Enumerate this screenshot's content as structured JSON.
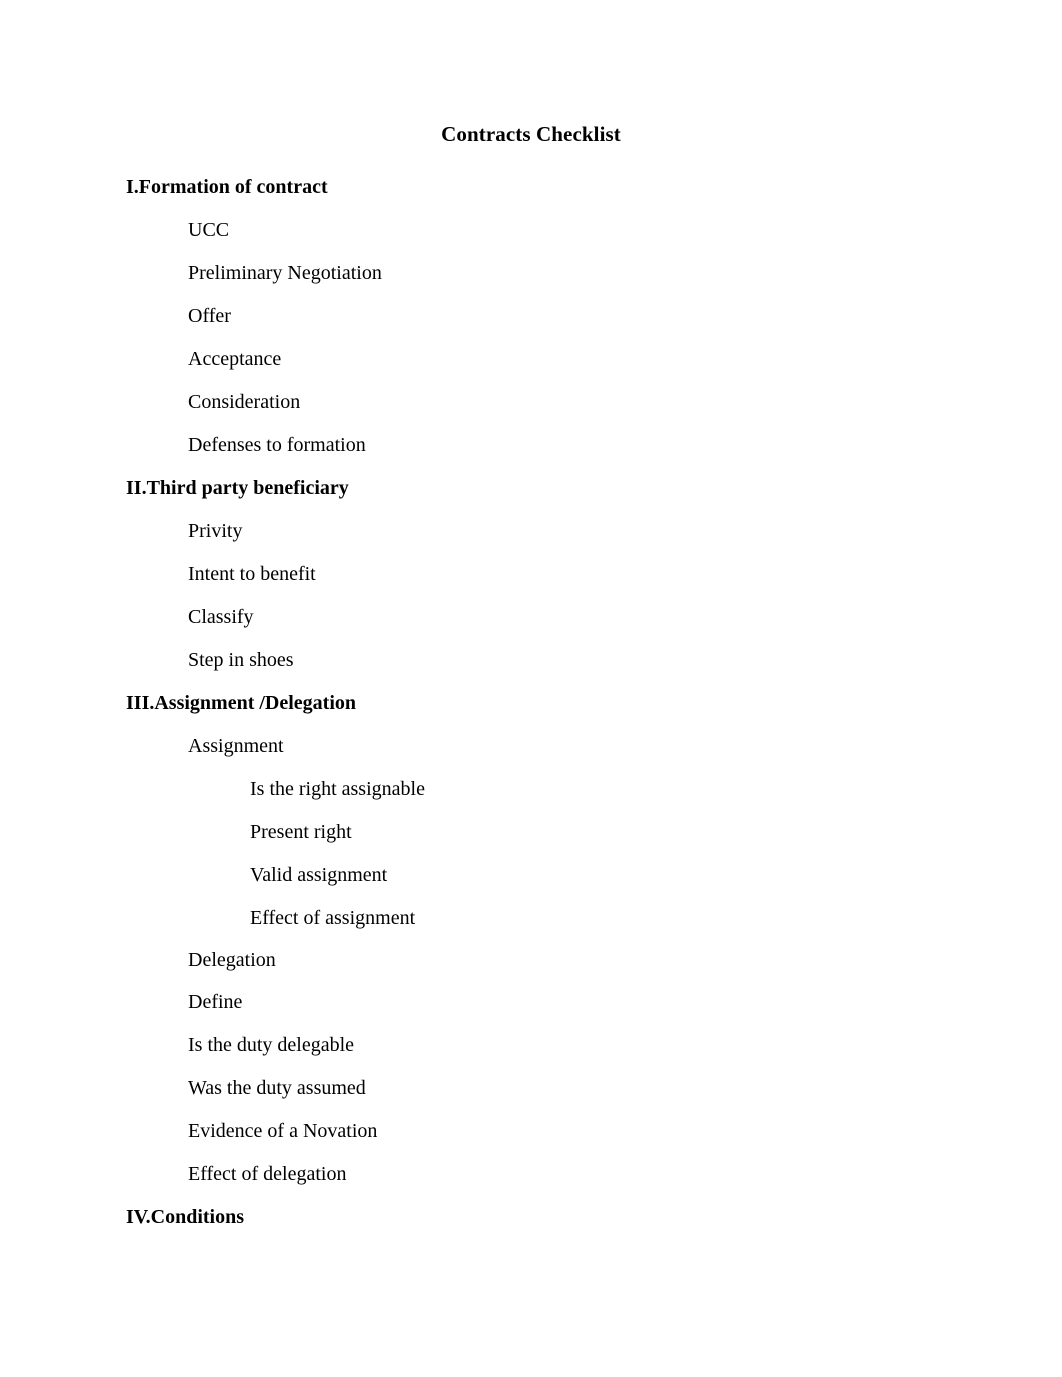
{
  "document": {
    "title": "Contracts Checklist",
    "page_background": "#ffffff",
    "text_color": "#000000"
  },
  "outline": [
    {
      "level": "heading",
      "text": "I.Formation of contract"
    },
    {
      "level": "item",
      "text": "UCC"
    },
    {
      "level": "item",
      "text": "Preliminary Negotiation"
    },
    {
      "level": "item",
      "text": "Offer"
    },
    {
      "level": "item",
      "text": "Acceptance"
    },
    {
      "level": "item",
      "text": "Consideration"
    },
    {
      "level": "item",
      "text": "Defenses to formation"
    },
    {
      "level": "heading",
      "text": "II.Third party beneficiary"
    },
    {
      "level": "item",
      "text": "Privity"
    },
    {
      "level": "item",
      "text": "Intent to benefit"
    },
    {
      "level": "item",
      "text": "Classify"
    },
    {
      "level": "item",
      "text": "Step in shoes"
    },
    {
      "level": "heading",
      "text": "III.Assignment /Delegation"
    },
    {
      "level": "item",
      "text": "Assignment"
    },
    {
      "level": "subitem",
      "text": "Is the right assignable"
    },
    {
      "level": "subitem",
      "text": "Present right"
    },
    {
      "level": "subitem",
      "text": "Valid assignment"
    },
    {
      "level": "subitem",
      "text": "Effect of assignment"
    },
    {
      "level": "item",
      "text": "Delegation"
    },
    {
      "level": "item",
      "text": "Define"
    },
    {
      "level": "item",
      "text": "Is the duty delegable"
    },
    {
      "level": "item",
      "text": "Was the duty assumed"
    },
    {
      "level": "item",
      "text": "Evidence of a Novation"
    },
    {
      "level": "item",
      "text": "Effect of delegation"
    },
    {
      "level": "heading",
      "text": "IV.Conditions"
    }
  ]
}
